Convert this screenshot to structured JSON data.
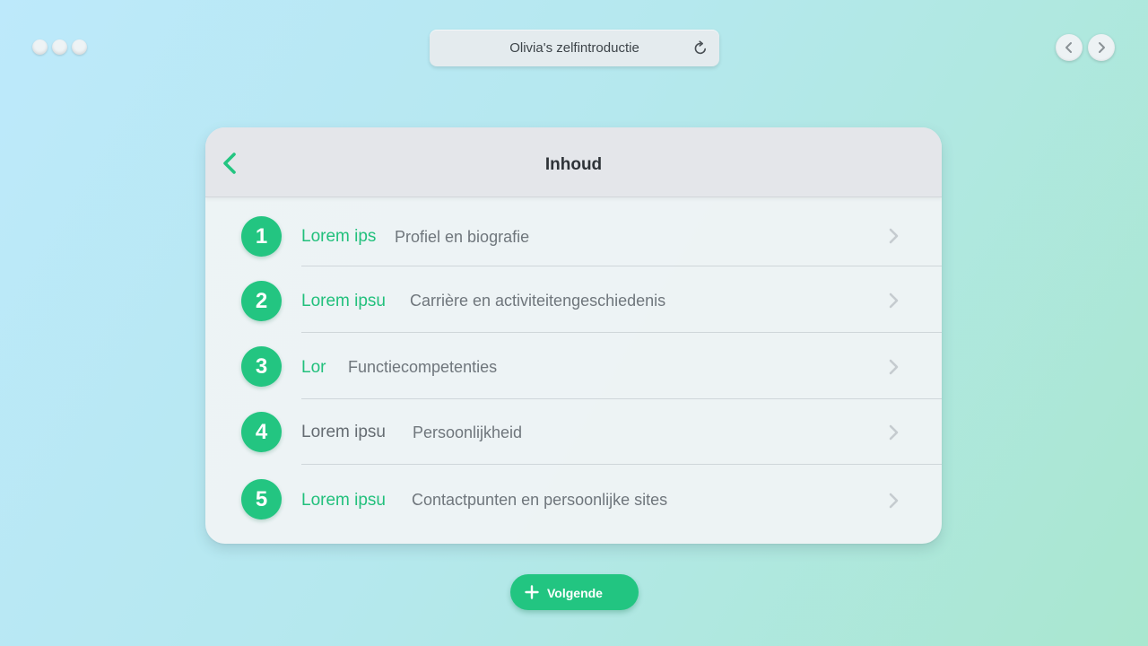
{
  "window": {
    "title": "Olivia's zelfintroductie"
  },
  "panel": {
    "heading": "Inhoud",
    "items": [
      {
        "number": "1",
        "short": "Lorem ips",
        "long": "Profiel en biografie",
        "short_color": "green"
      },
      {
        "number": "2",
        "short": "Lorem ipsu",
        "long": "Carrière en activiteitengeschiedenis",
        "short_color": "green"
      },
      {
        "number": "3",
        "short": "Lor",
        "long": "Functiecompetenties",
        "short_color": "green"
      },
      {
        "number": "4",
        "short": "Lorem ipsu",
        "long": "Persoonlijkheid",
        "short_color": "grey"
      },
      {
        "number": "5",
        "short": "Lorem ipsu",
        "long": "Contactpunten en persoonlijke sites",
        "short_color": "green"
      }
    ]
  },
  "footer": {
    "next_label": "Volgende"
  },
  "icons": {
    "window_dots": "window-dots",
    "reload": "reload-icon",
    "prev": "chevron-left-icon",
    "next": "chevron-right-icon",
    "back": "back-chevron-icon",
    "row": "chevron-right-icon",
    "plus": "plus-icon"
  },
  "colors": {
    "accent": "#23c581",
    "header_bg": "#e4e6ea",
    "panel_bg": "#eff4f5",
    "text_dark": "#2e3338",
    "text_muted": "#6f767c"
  }
}
